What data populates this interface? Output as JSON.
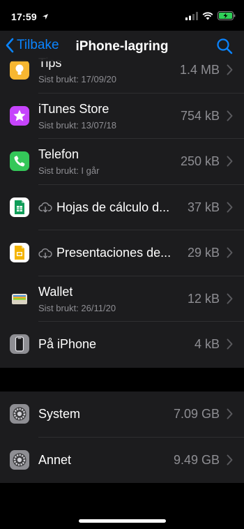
{
  "status_bar": {
    "time": "17:59"
  },
  "nav": {
    "back_label": "Tilbake",
    "title": "iPhone-lagring"
  },
  "apps": [
    {
      "name": "Tips",
      "subtitle": "Sist brukt: 17/09/20",
      "size": "1.4 MB",
      "icon": "tips-icon",
      "icon_color": "#f7b731"
    },
    {
      "name": "iTunes Store",
      "subtitle": "Sist brukt: 13/07/18",
      "size": "754 kB",
      "icon": "itunes-store-icon",
      "icon_color": "#c644fc"
    },
    {
      "name": "Telefon",
      "subtitle": "Sist brukt: I går",
      "size": "250 kB",
      "icon": "phone-icon",
      "icon_color": "#34c759"
    },
    {
      "name": "Hojas de cálculo d...",
      "size": "37 kB",
      "icon": "google-sheets-icon",
      "icon_color": "#0f9d58",
      "offloaded": true
    },
    {
      "name": "Presentaciones de...",
      "size": "29 kB",
      "icon": "google-slides-icon",
      "icon_color": "#f4b400",
      "offloaded": true
    },
    {
      "name": "Wallet",
      "subtitle": "Sist brukt: 26/11/20",
      "size": "12 kB",
      "icon": "wallet-icon",
      "icon_color": "#f2f2f2"
    },
    {
      "name": "På iPhone",
      "size": "4 kB",
      "icon": "on-iphone-icon",
      "icon_color": "#8e8e93"
    }
  ],
  "system_items": [
    {
      "name": "System",
      "size": "7.09 GB",
      "icon": "system-gear-icon"
    },
    {
      "name": "Annet",
      "size": "9.49 GB",
      "icon": "other-gear-icon"
    }
  ],
  "colors": {
    "accent": "#0a84ff",
    "background": "#000000",
    "row_background": "#1c1c1e",
    "secondary_text": "#8e8e93",
    "battery": "#30d158"
  }
}
